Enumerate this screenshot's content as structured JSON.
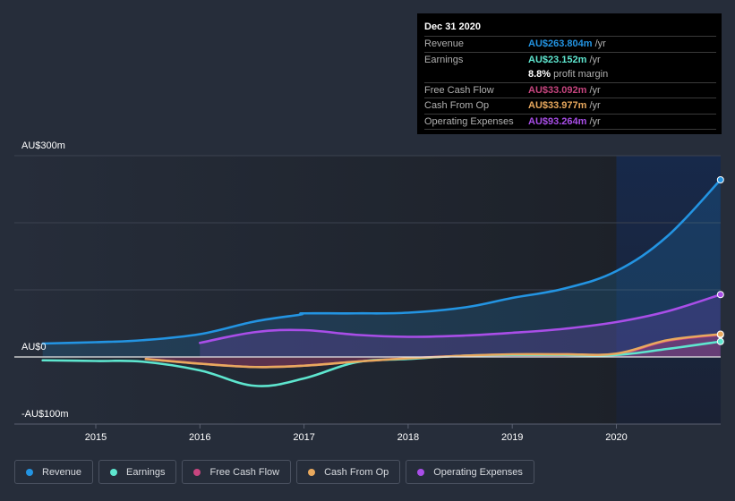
{
  "chart_data": {
    "type": "line",
    "title": "",
    "xlabel": "",
    "ylabel": "",
    "x_ticks": [
      "2015",
      "2016",
      "2017",
      "2018",
      "2019",
      "2020"
    ],
    "y_ticks": [
      {
        "value": 300,
        "label": "AU$300m"
      },
      {
        "value": 0,
        "label": "AU$0"
      },
      {
        "value": -100,
        "label": "-AU$100m"
      }
    ],
    "xlim": [
      2014.5,
      2021.0
    ],
    "ylim": [
      -100,
      300
    ],
    "grid": true,
    "forecast_region_start": 2020.0,
    "legend_position": "bottom-left",
    "series": [
      {
        "name": "Revenue",
        "color": "#2394e2",
        "fill": true,
        "x": [
          2014.49,
          2015.0,
          2015.45,
          2016.0,
          2016.53,
          2016.96,
          2017.0,
          2017.5,
          2018.0,
          2018.55,
          2019.0,
          2019.5,
          2020.0,
          2020.49,
          2021.0
        ],
        "values": [
          20,
          22,
          25,
          34,
          53,
          63,
          65,
          65,
          66,
          74,
          88,
          102,
          128,
          180,
          264
        ]
      },
      {
        "name": "Earnings",
        "color": "#5ee6cf",
        "fill": false,
        "x": [
          2014.49,
          2015.0,
          2015.45,
          2016.0,
          2016.53,
          2017.0,
          2017.5,
          2018.0,
          2018.55,
          2019.0,
          2019.5,
          2020.0,
          2020.49,
          2021.0
        ],
        "values": [
          -5,
          -6,
          -7,
          -20,
          -43,
          -32,
          -8,
          -3,
          2,
          3,
          3,
          3,
          12,
          23
        ]
      },
      {
        "name": "Free Cash Flow",
        "color": "#c7457f",
        "fill": true,
        "x": [
          2015.48,
          2016.0,
          2016.53,
          2017.0,
          2017.5,
          2018.0,
          2018.55,
          2019.0,
          2019.5,
          2020.0,
          2020.49,
          2021.0
        ],
        "values": [
          -3,
          -10,
          -15,
          -13,
          -7,
          -2,
          2,
          3,
          4,
          4,
          24,
          33
        ]
      },
      {
        "name": "Cash From Op",
        "color": "#e9a95e",
        "fill": false,
        "x": [
          2015.48,
          2016.0,
          2016.53,
          2017.0,
          2017.5,
          2018.0,
          2018.55,
          2019.0,
          2019.5,
          2020.0,
          2020.49,
          2021.0
        ],
        "values": [
          -3,
          -10,
          -15,
          -13,
          -7,
          -2,
          2,
          4,
          4,
          5,
          25,
          34
        ]
      },
      {
        "name": "Operating Expenses",
        "color": "#a94ee8",
        "fill": true,
        "x": [
          2016.0,
          2016.53,
          2017.0,
          2017.5,
          2018.0,
          2018.55,
          2019.0,
          2019.5,
          2020.0,
          2020.49,
          2021.0
        ],
        "values": [
          21,
          37,
          40,
          33,
          30,
          32,
          36,
          42,
          52,
          68,
          93
        ]
      }
    ]
  },
  "tooltip": {
    "date": "Dec 31 2020",
    "rows": [
      {
        "label": "Revenue",
        "value": "AU$263.804m",
        "unit": "/yr",
        "color": "#2394e2"
      },
      {
        "label": "Earnings",
        "value": "AU$23.152m",
        "unit": "/yr",
        "color": "#5ee6cf"
      },
      {
        "label": "",
        "value": "8.8%",
        "unit": "profit margin",
        "color": "#ffffff"
      },
      {
        "label": "Free Cash Flow",
        "value": "AU$33.092m",
        "unit": "/yr",
        "color": "#c7457f"
      },
      {
        "label": "Cash From Op",
        "value": "AU$33.977m",
        "unit": "/yr",
        "color": "#e9a95e"
      },
      {
        "label": "Operating Expenses",
        "value": "AU$93.264m",
        "unit": "/yr",
        "color": "#a94ee8"
      }
    ]
  },
  "legend": [
    {
      "label": "Revenue",
      "color": "#2394e2"
    },
    {
      "label": "Earnings",
      "color": "#5ee6cf"
    },
    {
      "label": "Free Cash Flow",
      "color": "#c7457f"
    },
    {
      "label": "Cash From Op",
      "color": "#e9a95e"
    },
    {
      "label": "Operating Expenses",
      "color": "#a94ee8"
    }
  ]
}
